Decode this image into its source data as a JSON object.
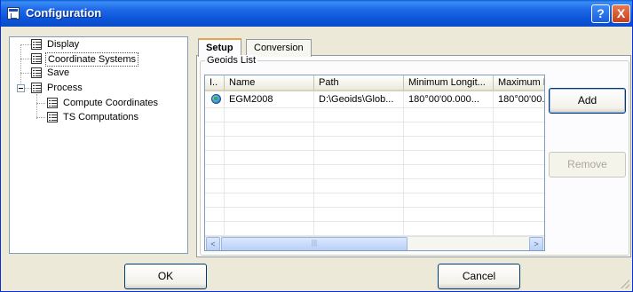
{
  "window": {
    "title": "Configuration",
    "help_label": "?",
    "close_label": "X"
  },
  "tree": {
    "items": [
      {
        "label": "Display",
        "icon": "list-icon"
      },
      {
        "label": "Coordinate Systems",
        "icon": "list-icon",
        "selected": true
      },
      {
        "label": "Save",
        "icon": "list-icon"
      },
      {
        "label": "Process",
        "icon": "list-icon",
        "expanded": true
      },
      {
        "label": "Compute Coordinates",
        "icon": "list-icon"
      },
      {
        "label": "TS Computations",
        "icon": "list-icon"
      }
    ]
  },
  "tabs": [
    {
      "label": "Setup",
      "active": true
    },
    {
      "label": "Conversion",
      "active": false
    }
  ],
  "geoids": {
    "group_title": "Geoids List",
    "columns": [
      "I..",
      "Name",
      "Path",
      "Minimum Longit...",
      "Maximum L"
    ],
    "rows": [
      {
        "icon": "globe-icon",
        "name": "EGM2008",
        "path": "D:\\Geoids\\Glob...",
        "min_longitude": "180°00'00.000...",
        "max_longitude": "180°00'00."
      }
    ],
    "scroll_left": "<",
    "scroll_right": ">",
    "scroll_thumb": "|||"
  },
  "buttons": {
    "add": "Add",
    "remove": "Remove",
    "ok": "OK",
    "cancel": "Cancel"
  },
  "colors": {
    "titlebar": "#0A4CC8",
    "selected_tab_accent": "#E7A54B",
    "face": "#ECE9D8"
  }
}
